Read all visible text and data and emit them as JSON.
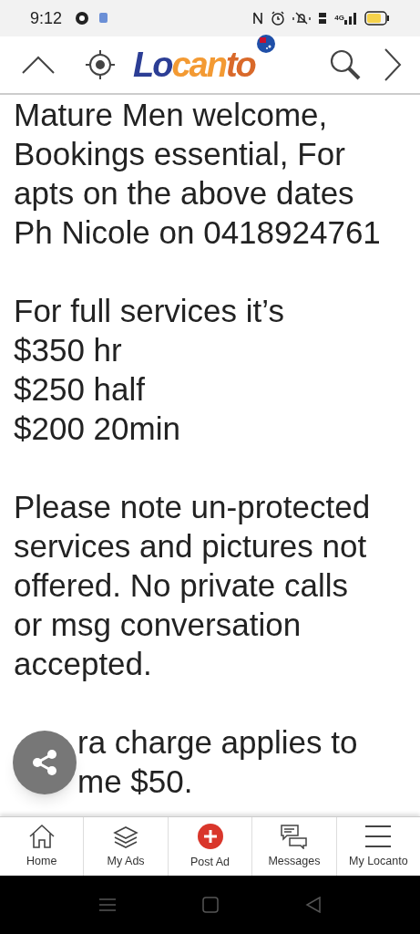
{
  "status_bar": {
    "time": "9:12",
    "network": "4G"
  },
  "header": {
    "logo": [
      {
        "text": "Lo",
        "color": "#2c3e95"
      },
      {
        "text": "can",
        "color": "#f39a33"
      },
      {
        "text": "to",
        "color": "#d9692a"
      }
    ]
  },
  "ad_text": [
    "Mature Men welcome,\nBookings essential, For\napts on the above dates\nPh Nicole on 0418924761",
    "For full services it’s\n$350 hr\n$250 half\n$200 20min",
    "Please note un-protected\nservices and pictures not\noffered. No private calls\nor msg conversation\naccepted.",
    {
      "text": "ra charge applies to\nme $50.",
      "kind": "partly_covered"
    }
  ],
  "bottom_nav": [
    {
      "label": "Home",
      "kind": "home"
    },
    {
      "label": "My Ads",
      "kind": "ads"
    },
    {
      "label": "Post Ad",
      "kind": "post"
    },
    {
      "label": "Messages",
      "kind": "messages"
    },
    {
      "label": "My Locanto",
      "kind": "menu"
    }
  ]
}
